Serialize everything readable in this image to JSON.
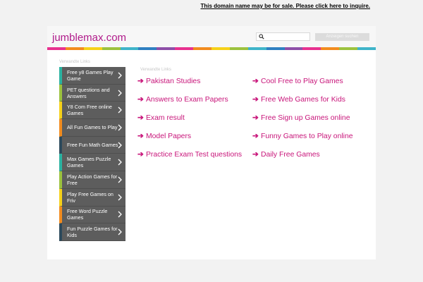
{
  "notice": {
    "text": "This domain name may be for sale. Please click here to inquire."
  },
  "header": {
    "logo": "jumblemax.com",
    "search_placeholder": "",
    "search_button": "Anzeigen suchen"
  },
  "colors": {
    "brand": "#b01a8a",
    "link": "#c8157a",
    "rainbow": [
      "#e8318f",
      "#f28c1f",
      "#f6d11a",
      "#9cc23e",
      "#3fb4c9",
      "#2f7fc1",
      "#8e4fa8",
      "#e8318f",
      "#f28c1f",
      "#f6d11a",
      "#9cc23e",
      "#3fb4c9",
      "#2f7fc1",
      "#8e4fa8",
      "#e8318f",
      "#f28c1f",
      "#9cc23e",
      "#3fb4c9"
    ]
  },
  "sidebar": {
    "heading": "Verwandte Links",
    "items": [
      {
        "label": "Free y8 Games Play Game",
        "accent": "#2bb3a1"
      },
      {
        "label": "PET questions and Answers",
        "accent": "#9cc23e"
      },
      {
        "label": "Y8 Com Free online Games",
        "accent": "#f6d11a"
      },
      {
        "label": "All Fun Games to Play",
        "accent": "#f28c1f"
      },
      {
        "label": "Free Fun Math Games",
        "accent": "#2d4a5c"
      },
      {
        "label": "Max Games Puzzle Games",
        "accent": "#2bb3a1"
      },
      {
        "label": "Play Action Games for Free",
        "accent": "#9cc23e"
      },
      {
        "label": "Play Free Games on Friv",
        "accent": "#f6d11a"
      },
      {
        "label": "Free Word Puzzle Games",
        "accent": "#f28c1f"
      },
      {
        "label": "Fun Puzzle Games for Kids",
        "accent": "#2d4a5c"
      }
    ]
  },
  "main": {
    "heading": "Verwandte Links",
    "arrow": "➔",
    "col1": [
      "Pakistan Studies",
      "Answers to Exam Papers",
      "Exam result",
      "Model Papers",
      "Practice Exam Test questions"
    ],
    "col2": [
      "Cool Free to Play Games",
      "Free Web Games for Kids",
      "Free Sign up Games online",
      "Funny Games to Play online",
      "Daily Free Games"
    ]
  }
}
